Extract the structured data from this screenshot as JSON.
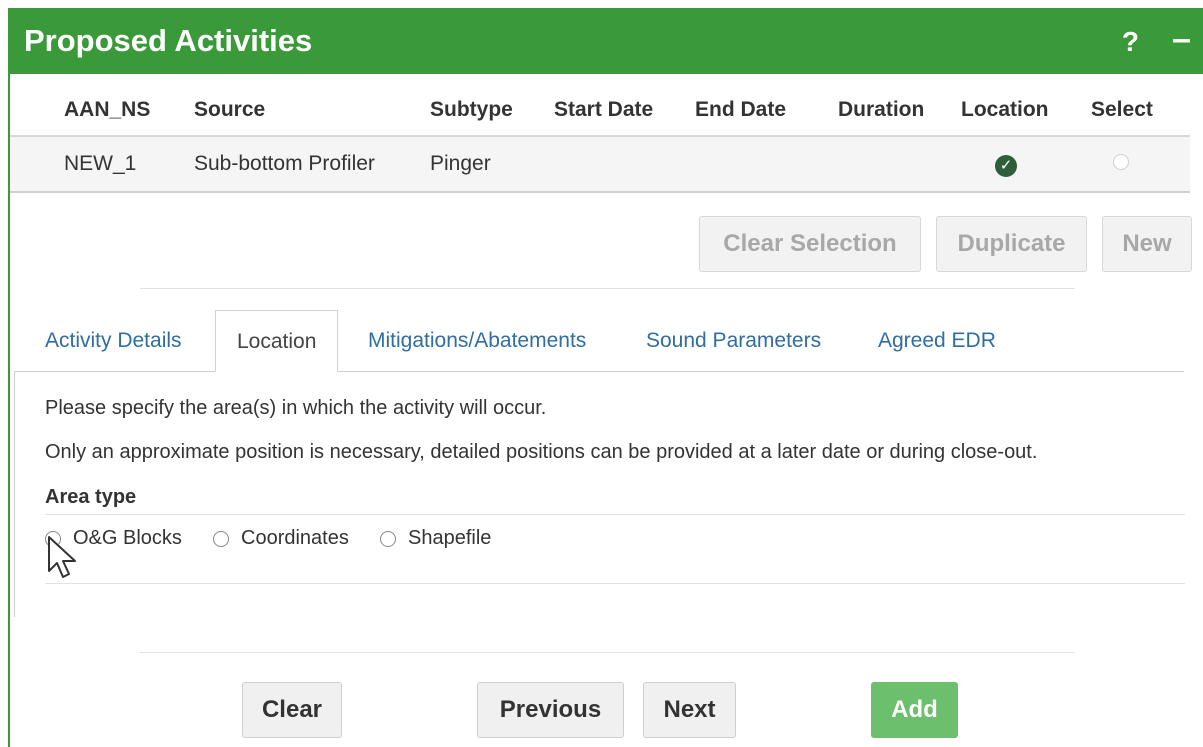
{
  "header": {
    "title": "Proposed Activities",
    "help_label": "?",
    "minimize_label": "–"
  },
  "table": {
    "columns": [
      "AAN_NS",
      "Source",
      "Subtype",
      "Start Date",
      "End Date",
      "Duration",
      "Location",
      "Select"
    ],
    "rows": [
      {
        "aan_ns": "NEW_1",
        "source": "Sub-bottom Profiler",
        "subtype": "Pinger",
        "start_date": "",
        "end_date": "",
        "duration": "",
        "location_icon": "check-circle-icon",
        "select": "unselected"
      }
    ]
  },
  "row_actions": {
    "clear_selection": "Clear Selection",
    "duplicate": "Duplicate",
    "new": "New"
  },
  "tabs": [
    {
      "label": "Activity Details",
      "active": false
    },
    {
      "label": "Location",
      "active": true
    },
    {
      "label": "Mitigations/Abatements",
      "active": false
    },
    {
      "label": "Sound Parameters",
      "active": false
    },
    {
      "label": "Agreed EDR",
      "active": false
    }
  ],
  "location": {
    "instruction_1": "Please specify the area(s) in which the activity will occur.",
    "instruction_2": "Only an approximate position is necessary, detailed positions can be provided at a later date or during close-out.",
    "area_type_label": "Area type",
    "area_options": [
      "O&G Blocks",
      "Coordinates",
      "Shapefile"
    ]
  },
  "footer": {
    "clear": "Clear",
    "previous": "Previous",
    "next": "Next",
    "add": "Add"
  },
  "colors": {
    "header_green": "#3a9a3a",
    "add_green": "#6cbf6c",
    "link_blue": "#2f6ea3",
    "check_green": "#2f5f3a"
  }
}
